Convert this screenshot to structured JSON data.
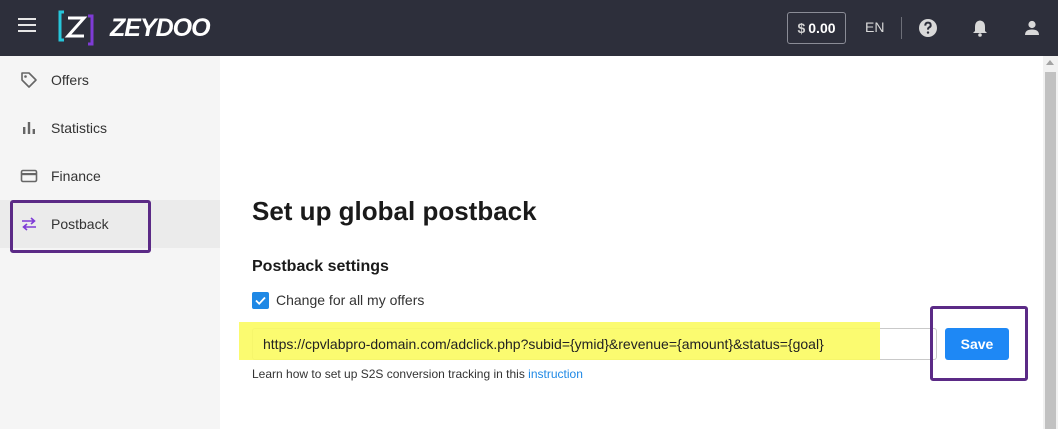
{
  "header": {
    "logo_text": "ZEYDOO",
    "balance": {
      "currency": "$",
      "amount": "0.00"
    },
    "language": "EN"
  },
  "sidebar": {
    "items": [
      {
        "label": "Offers",
        "icon": "tag-icon"
      },
      {
        "label": "Statistics",
        "icon": "bar-chart-icon"
      },
      {
        "label": "Finance",
        "icon": "credit-card-icon"
      },
      {
        "label": "Postback",
        "icon": "swap-arrows-icon",
        "active": true
      }
    ]
  },
  "main": {
    "title": "Set up global postback",
    "section_title": "Postback settings",
    "checkbox_label": "Change for all my offers",
    "checkbox_checked": true,
    "postback_url": "https://cpvlabpro-domain.com/adclick.php?subid={ymid}&revenue={amount}&status={goal}",
    "save_label": "Save",
    "help_prefix": "Learn how to set up S2S conversion tracking in this",
    "help_link": "instruction"
  },
  "colors": {
    "topbar": "#2d2f3b",
    "accent": "#1e88f5",
    "annotation_box": "#5b2a86",
    "highlight": "#fbfb61",
    "brand_teal": "#26c6da",
    "brand_purple": "#7e3bd6"
  }
}
